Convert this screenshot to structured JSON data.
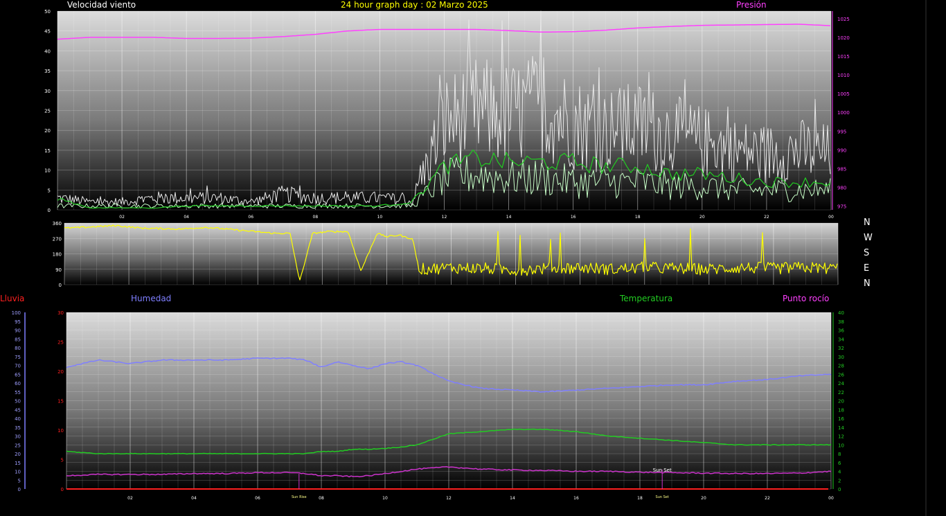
{
  "header": {
    "wind_title": "Velocidad viento",
    "graph_title": "24 hour graph day : 02 Marzo 2025",
    "pressure_title": "Presión"
  },
  "compass": {
    "letters": [
      "N",
      "W",
      "S",
      "E",
      "N"
    ]
  },
  "lower_legend": {
    "rain": "Lluvia",
    "humidity": "Humedad",
    "temperature": "Temperatura",
    "dewpoint": "Punto rocío"
  },
  "colors": {
    "wind_title": "#ffffff",
    "graph_title": "#ffff00",
    "pressure": "#ff40ff",
    "gust": "#e8e8e8",
    "wind_avg": "#c8ffc8",
    "wind_avg_green": "#22cc22",
    "direction": "#ffff00",
    "humidity": "#7f7fff",
    "temperature": "#22cc22",
    "dewpoint": "#cc33cc",
    "rain": "#ff2020"
  },
  "chart_data": [
    {
      "type": "line",
      "name": "wind-pressure",
      "x_ticks": [
        "02",
        "04",
        "06",
        "08",
        "10",
        "12",
        "14",
        "16",
        "18",
        "20",
        "22",
        "00"
      ],
      "hours": [
        0,
        1,
        2,
        3,
        4,
        5,
        6,
        7,
        8,
        9,
        10,
        11,
        12,
        13,
        14,
        15,
        16,
        17,
        18,
        19,
        20,
        21,
        22,
        23,
        24
      ],
      "y_left_ticks": [
        "0",
        "5",
        "10",
        "15",
        "20",
        "25",
        "30",
        "35",
        "40",
        "45",
        "50"
      ],
      "ylim_left": [
        0,
        50
      ],
      "y_right_ticks": [
        "975",
        "980",
        "985",
        "990",
        "995",
        "1000",
        "1005",
        "1010",
        "1015",
        "1020",
        "1025"
      ],
      "ylim_right": [
        974,
        1027
      ],
      "series": [
        {
          "key": "pressure",
          "axis": "right",
          "values": [
            1019.5,
            1020,
            1020,
            1020,
            1019.7,
            1019.7,
            1019.8,
            1020.2,
            1020.8,
            1021.7,
            1022.1,
            1022.1,
            1022.1,
            1022.1,
            1021.8,
            1021.4,
            1021.5,
            1021.9,
            1022.5,
            1022.9,
            1023.2,
            1023.3,
            1023.4,
            1023.5,
            1023.1
          ]
        },
        {
          "key": "gust",
          "axis": "left",
          "values": [
            3,
            2,
            2,
            3,
            3,
            3,
            2,
            4,
            3,
            3,
            3,
            2,
            22,
            25,
            24,
            26,
            22,
            20,
            21,
            19,
            17,
            15,
            14,
            15,
            14
          ]
        },
        {
          "key": "wind_avg",
          "axis": "left",
          "values": [
            1,
            1,
            1,
            1,
            1,
            1,
            1,
            1,
            1,
            1,
            1,
            1,
            8,
            9,
            8,
            8,
            7,
            7,
            7,
            6,
            6,
            5,
            5,
            5,
            5
          ]
        },
        {
          "key": "wind_avg_green",
          "axis": "left",
          "values": [
            3,
            0.5,
            0.5,
            0.5,
            1,
            1,
            1,
            1,
            1,
            1,
            1,
            2,
            11,
            13,
            12,
            12,
            12,
            11,
            11,
            9,
            9,
            8,
            7,
            7,
            7
          ]
        }
      ]
    },
    {
      "type": "line",
      "name": "wind-direction",
      "x_ticks": [],
      "hours": [
        0,
        0.6,
        1.6,
        2.4,
        3.6,
        4.4,
        5.6,
        6.5,
        7.0,
        7.3,
        7.7,
        8.2,
        8.8,
        9.2,
        9.7,
        10.0,
        10.4,
        10.6,
        10.8,
        11,
        12,
        13,
        14,
        15,
        16,
        17,
        18,
        19,
        20,
        21,
        22,
        23,
        24
      ],
      "y_ticks": [
        "0",
        "90",
        "180",
        "270",
        "360"
      ],
      "ylim": [
        0,
        360
      ],
      "series": [
        {
          "key": "direction",
          "values": [
            330,
            335,
            345,
            330,
            325,
            335,
            315,
            300,
            300,
            20,
            300,
            310,
            310,
            80,
            300,
            280,
            290,
            275,
            270,
            90,
            100,
            95,
            85,
            95,
            100,
            90,
            100,
            95,
            90,
            100,
            95,
            100,
            95
          ]
        }
      ]
    },
    {
      "type": "line",
      "name": "humidity-temperature",
      "x_ticks": [
        "02",
        "04",
        "06",
        "08",
        "10",
        "12",
        "14",
        "16",
        "18",
        "20",
        "22",
        "00"
      ],
      "hours": [
        0,
        1,
        2,
        3,
        4,
        5,
        6,
        7,
        7.5,
        8,
        8.5,
        9,
        9.5,
        10,
        10.5,
        11,
        12,
        13,
        14,
        15,
        16,
        17,
        18,
        19,
        20,
        21,
        22,
        23,
        24
      ],
      "y_rain_ticks": [
        "0",
        "5",
        "10",
        "15",
        "20",
        "25",
        "30"
      ],
      "ylim_rain": [
        0,
        30
      ],
      "y_humidity_ticks": [
        "0",
        "5",
        "10",
        "15",
        "20",
        "25",
        "30",
        "35",
        "40",
        "45",
        "50",
        "55",
        "60",
        "65",
        "70",
        "75",
        "80",
        "85",
        "90",
        "95",
        "100"
      ],
      "ylim_humidity": [
        0,
        100
      ],
      "y_temp_ticks": [
        "0",
        "2",
        "4",
        "6",
        "8",
        "10",
        "12",
        "14",
        "16",
        "18",
        "20",
        "22",
        "24",
        "26",
        "28",
        "30",
        "32",
        "34",
        "36",
        "38",
        "40"
      ],
      "ylim_temp": [
        0,
        40
      ],
      "annotations": [
        "Sun Rise",
        "Sun Set"
      ],
      "series": [
        {
          "key": "humidity",
          "axis": "humidity",
          "values": [
            69,
            73,
            71,
            73,
            73,
            73,
            74,
            74,
            73,
            69,
            72,
            70,
            68,
            71,
            72,
            70,
            61,
            57,
            56,
            55,
            56,
            57,
            58,
            59,
            59,
            61,
            62,
            64,
            65
          ]
        },
        {
          "key": "temperature",
          "axis": "temp",
          "values": [
            8.5,
            8,
            8,
            8,
            8,
            8,
            8,
            8,
            8,
            8.5,
            8.5,
            9,
            9,
            9.2,
            9.5,
            10,
            12.5,
            13,
            13.5,
            13.5,
            13,
            12,
            11.5,
            11,
            10.5,
            10,
            10,
            10,
            10
          ]
        },
        {
          "key": "dewpoint",
          "axis": "temp",
          "values": [
            3,
            3.3,
            3.3,
            3.3,
            3.5,
            3.5,
            3.7,
            3.7,
            3.5,
            3,
            3,
            2.8,
            3,
            3.5,
            4,
            4.5,
            5,
            4.5,
            4.3,
            4.2,
            4,
            4,
            3.8,
            3.7,
            3.6,
            3.5,
            3.5,
            3.6,
            4
          ]
        },
        {
          "key": "rain",
          "axis": "rain",
          "values": [
            0,
            0,
            0,
            0,
            0,
            0,
            0,
            0,
            0,
            0,
            0,
            0,
            0,
            0,
            0,
            0,
            0,
            0,
            0,
            0,
            0,
            0,
            0,
            0,
            0,
            0,
            0,
            0,
            0
          ]
        }
      ]
    }
  ]
}
